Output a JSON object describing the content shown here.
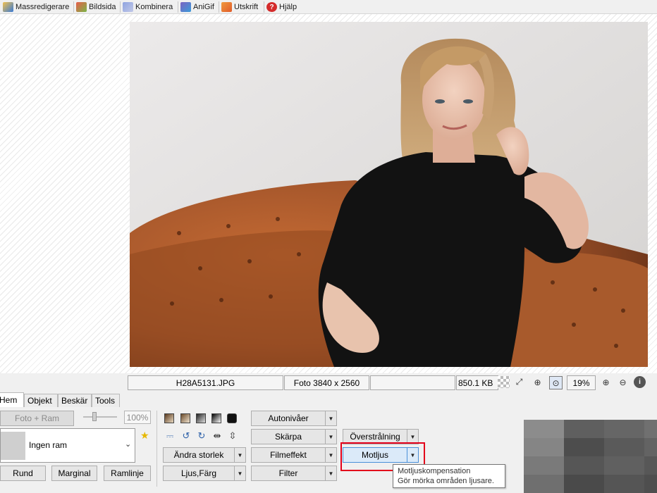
{
  "menu": {
    "items": [
      {
        "label": "Massredigerare",
        "icon": "batch-edit-icon",
        "color": "#d99a2b"
      },
      {
        "label": "Bildsida",
        "icon": "image-page-icon",
        "color": "#c94a3a"
      },
      {
        "label": "Kombinera",
        "icon": "combine-icon",
        "color": "#6c7fc2"
      },
      {
        "label": "AniGif",
        "icon": "anigif-icon",
        "color": "#6f5aa8"
      },
      {
        "label": "Utskrift",
        "icon": "print-icon",
        "color": "#e07a2a"
      },
      {
        "label": "Hjälp",
        "icon": "help-icon",
        "color": "#d42b2b"
      }
    ]
  },
  "status": {
    "filename": "H28A5131.JPG",
    "dimensions": "Foto 3840 x 2560",
    "filesize": "850.1 KB",
    "zoom": "19%"
  },
  "tabs": [
    "Hem",
    "Objekt",
    "Beskär",
    "Tools"
  ],
  "frame_group": {
    "photo_frame_button": "Foto + Ram",
    "opacity": "100%",
    "frame_select": "Ingen ram",
    "round": "Rund",
    "margin": "Marginal",
    "frame_line": "Ramlinje"
  },
  "tools": {
    "resize": "Ändra storlek",
    "light_color": "Ljus,Färg",
    "auto_levels": "Autonivåer",
    "sharpen": "Skärpa",
    "film_effect": "Filmeffekt",
    "filter": "Filter",
    "overexposure": "Överstrålning",
    "backlight": "Motljus"
  },
  "tooltip": {
    "title": "Motljuskompensation",
    "description": "Gör mörka områden ljusare."
  },
  "colors": {
    "highlight": "#e3001b",
    "sofa": "#a0532a",
    "wall": "#e4e4e2"
  }
}
